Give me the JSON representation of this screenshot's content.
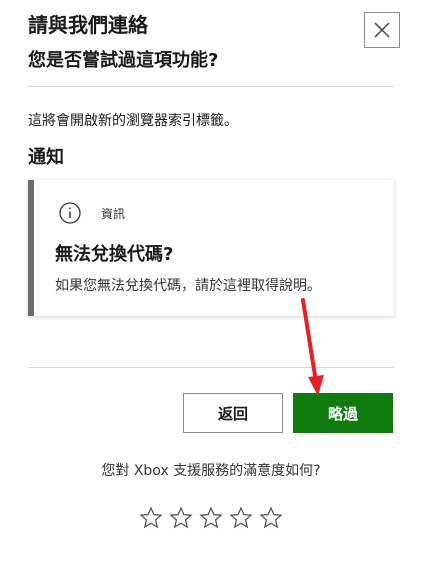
{
  "header": {
    "title": "請與我們連絡",
    "subtitle": "您是否嘗試過這項功能?",
    "close_icon": "close-icon"
  },
  "info_text": "這將會開啟新的瀏覽器索引標籤。",
  "section_title": "通知",
  "notice_card": {
    "icon": "info-icon",
    "label": "資訊",
    "heading": "無法兌換代碼?",
    "description": "如果您無法兌換代碼，請於這裡取得說明。"
  },
  "actions": {
    "back_label": "返回",
    "skip_label": "略過",
    "skip_color": "#107c10"
  },
  "survey": {
    "question": "您對 Xbox 支援服務的滿意度如何?",
    "stars": [
      "star-1",
      "star-2",
      "star-3",
      "star-4",
      "star-5"
    ]
  },
  "annotation_color": "#e8202a"
}
